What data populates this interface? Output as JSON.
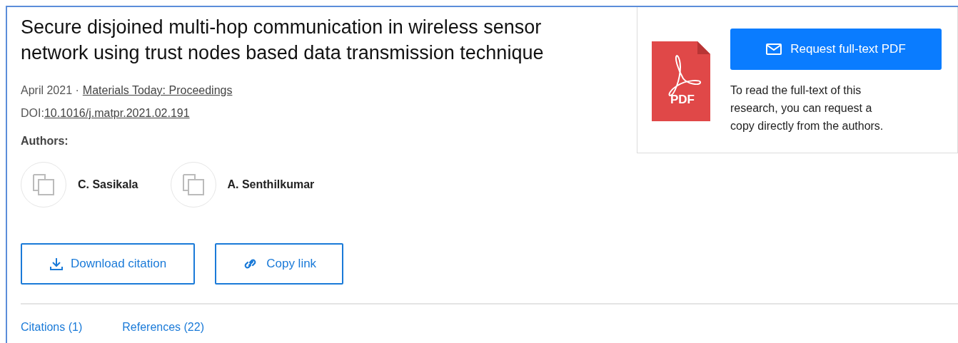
{
  "title": "Secure disjoined multi-hop communication in wireless sensor network using trust nodes based data transmission technique",
  "meta": {
    "date": "April 2021",
    "separator": "·",
    "journal": "Materials Today: Proceedings",
    "doi_label": "DOI:",
    "doi": "10.1016/j.matpr.2021.02.191"
  },
  "authors_label": "Authors:",
  "authors": [
    {
      "name": "C. Sasikala"
    },
    {
      "name": "A. Senthilkumar"
    }
  ],
  "actions": [
    {
      "kind": "download",
      "label": "Download citation"
    },
    {
      "kind": "link",
      "label": "Copy link"
    }
  ],
  "fulltext": {
    "button": "Request full-text PDF",
    "note": "To read the full-text of this research, you can request a copy directly from the authors.",
    "icon_label": "PDF"
  },
  "tabs": [
    {
      "label": "Citations (1)"
    },
    {
      "label": "References (22)"
    }
  ]
}
